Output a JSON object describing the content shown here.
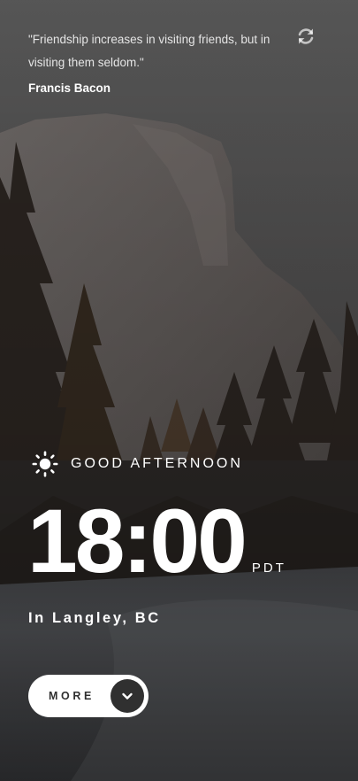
{
  "quote": {
    "text": "\"Friendship increases in visiting friends, but in visiting them seldom.\"",
    "author": "Francis Bacon"
  },
  "icons": {
    "refresh": "refresh-icon",
    "greeting": "sun-icon",
    "more": "chevron-down-icon"
  },
  "greeting": {
    "text": "GOOD AFTERNOON"
  },
  "clock": {
    "time": "18:00",
    "timezone": "PDT"
  },
  "location": {
    "text": "In Langley, BC"
  },
  "more_button": {
    "label": "MORE"
  },
  "colors": {
    "button_bg": "#ffffff",
    "button_text": "#303030",
    "button_circle": "#303030"
  }
}
